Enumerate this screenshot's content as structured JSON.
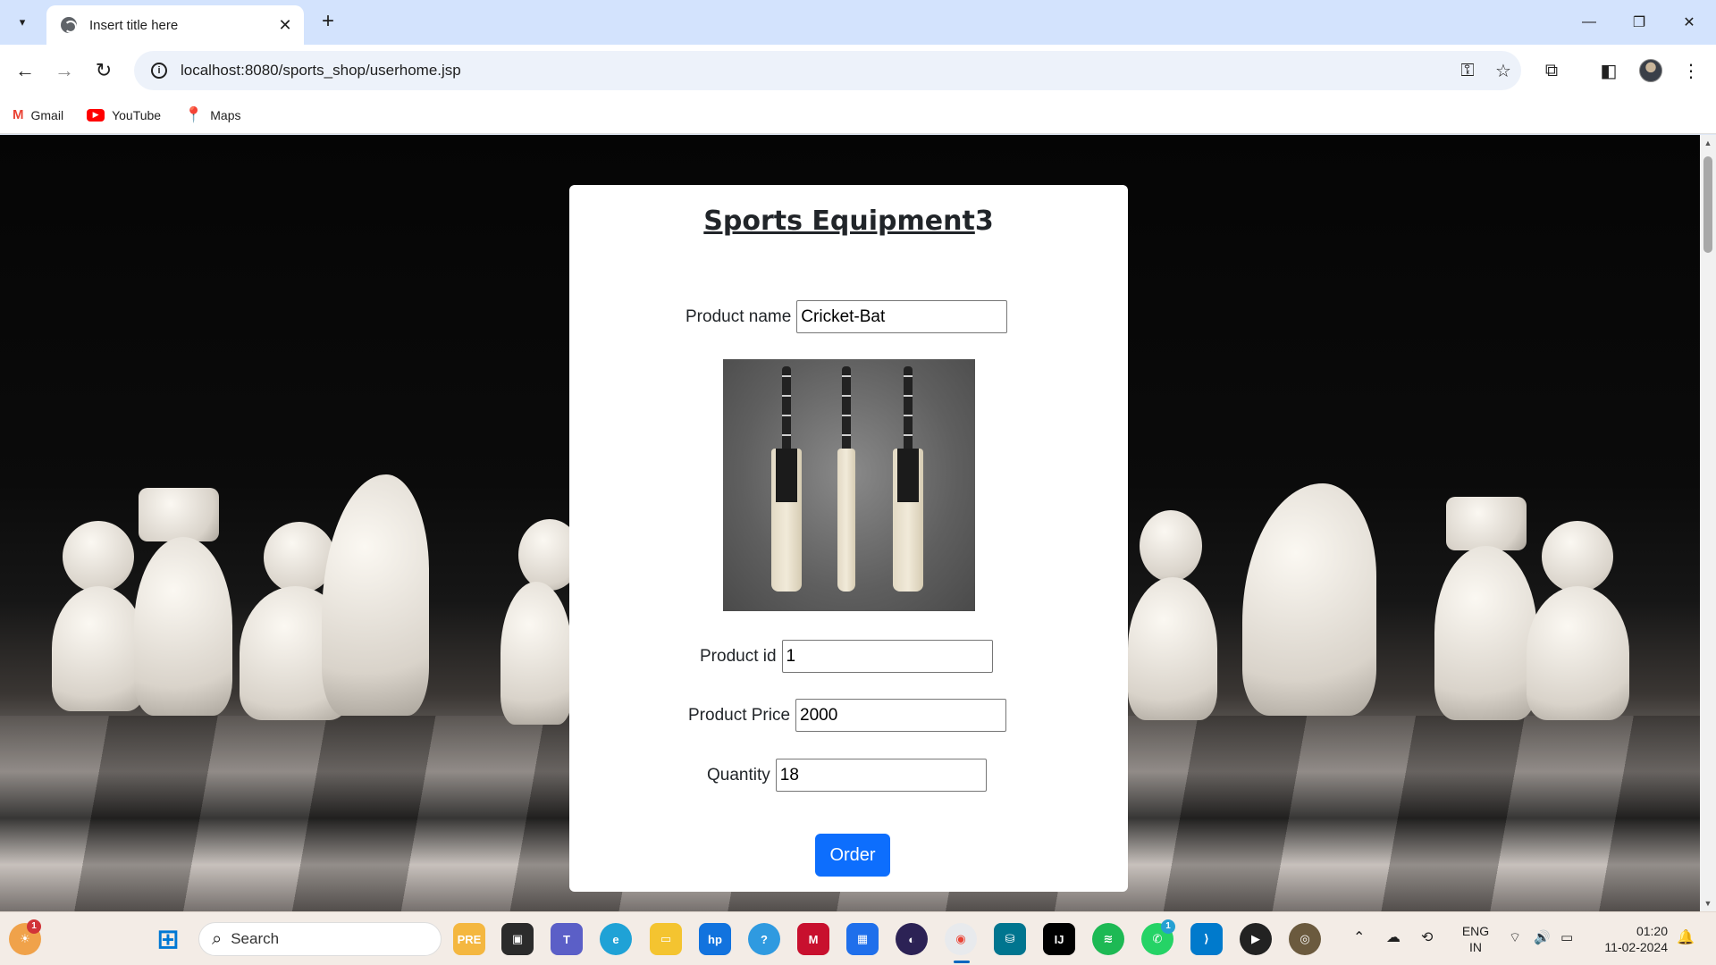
{
  "browser": {
    "tab_title": "Insert title here",
    "url": "localhost:8080/sports_shop/userhome.jsp",
    "bookmarks": [
      {
        "label": "Gmail",
        "icon": "gmail-icon"
      },
      {
        "label": "YouTube",
        "icon": "youtube-icon"
      },
      {
        "label": "Maps",
        "icon": "maps-icon"
      }
    ]
  },
  "page": {
    "title_main": "Sports Equipment",
    "title_suffix": "3",
    "product_name_label": "Product name",
    "product_name_value": "Cricket-Bat",
    "product_id_label": "Product id",
    "product_id_value": "1",
    "product_price_label": "Product Price",
    "product_price_value": "2000",
    "quantity_label": "Quantity",
    "quantity_value": "18",
    "order_button": "Order",
    "accent_color": "#0d6efd"
  },
  "taskbar": {
    "search_placeholder": "Search",
    "language": "ENG",
    "region": "IN",
    "time": "01:20",
    "date": "11-02-2024",
    "weather_badge": "1",
    "whatsapp_badge": "1"
  }
}
